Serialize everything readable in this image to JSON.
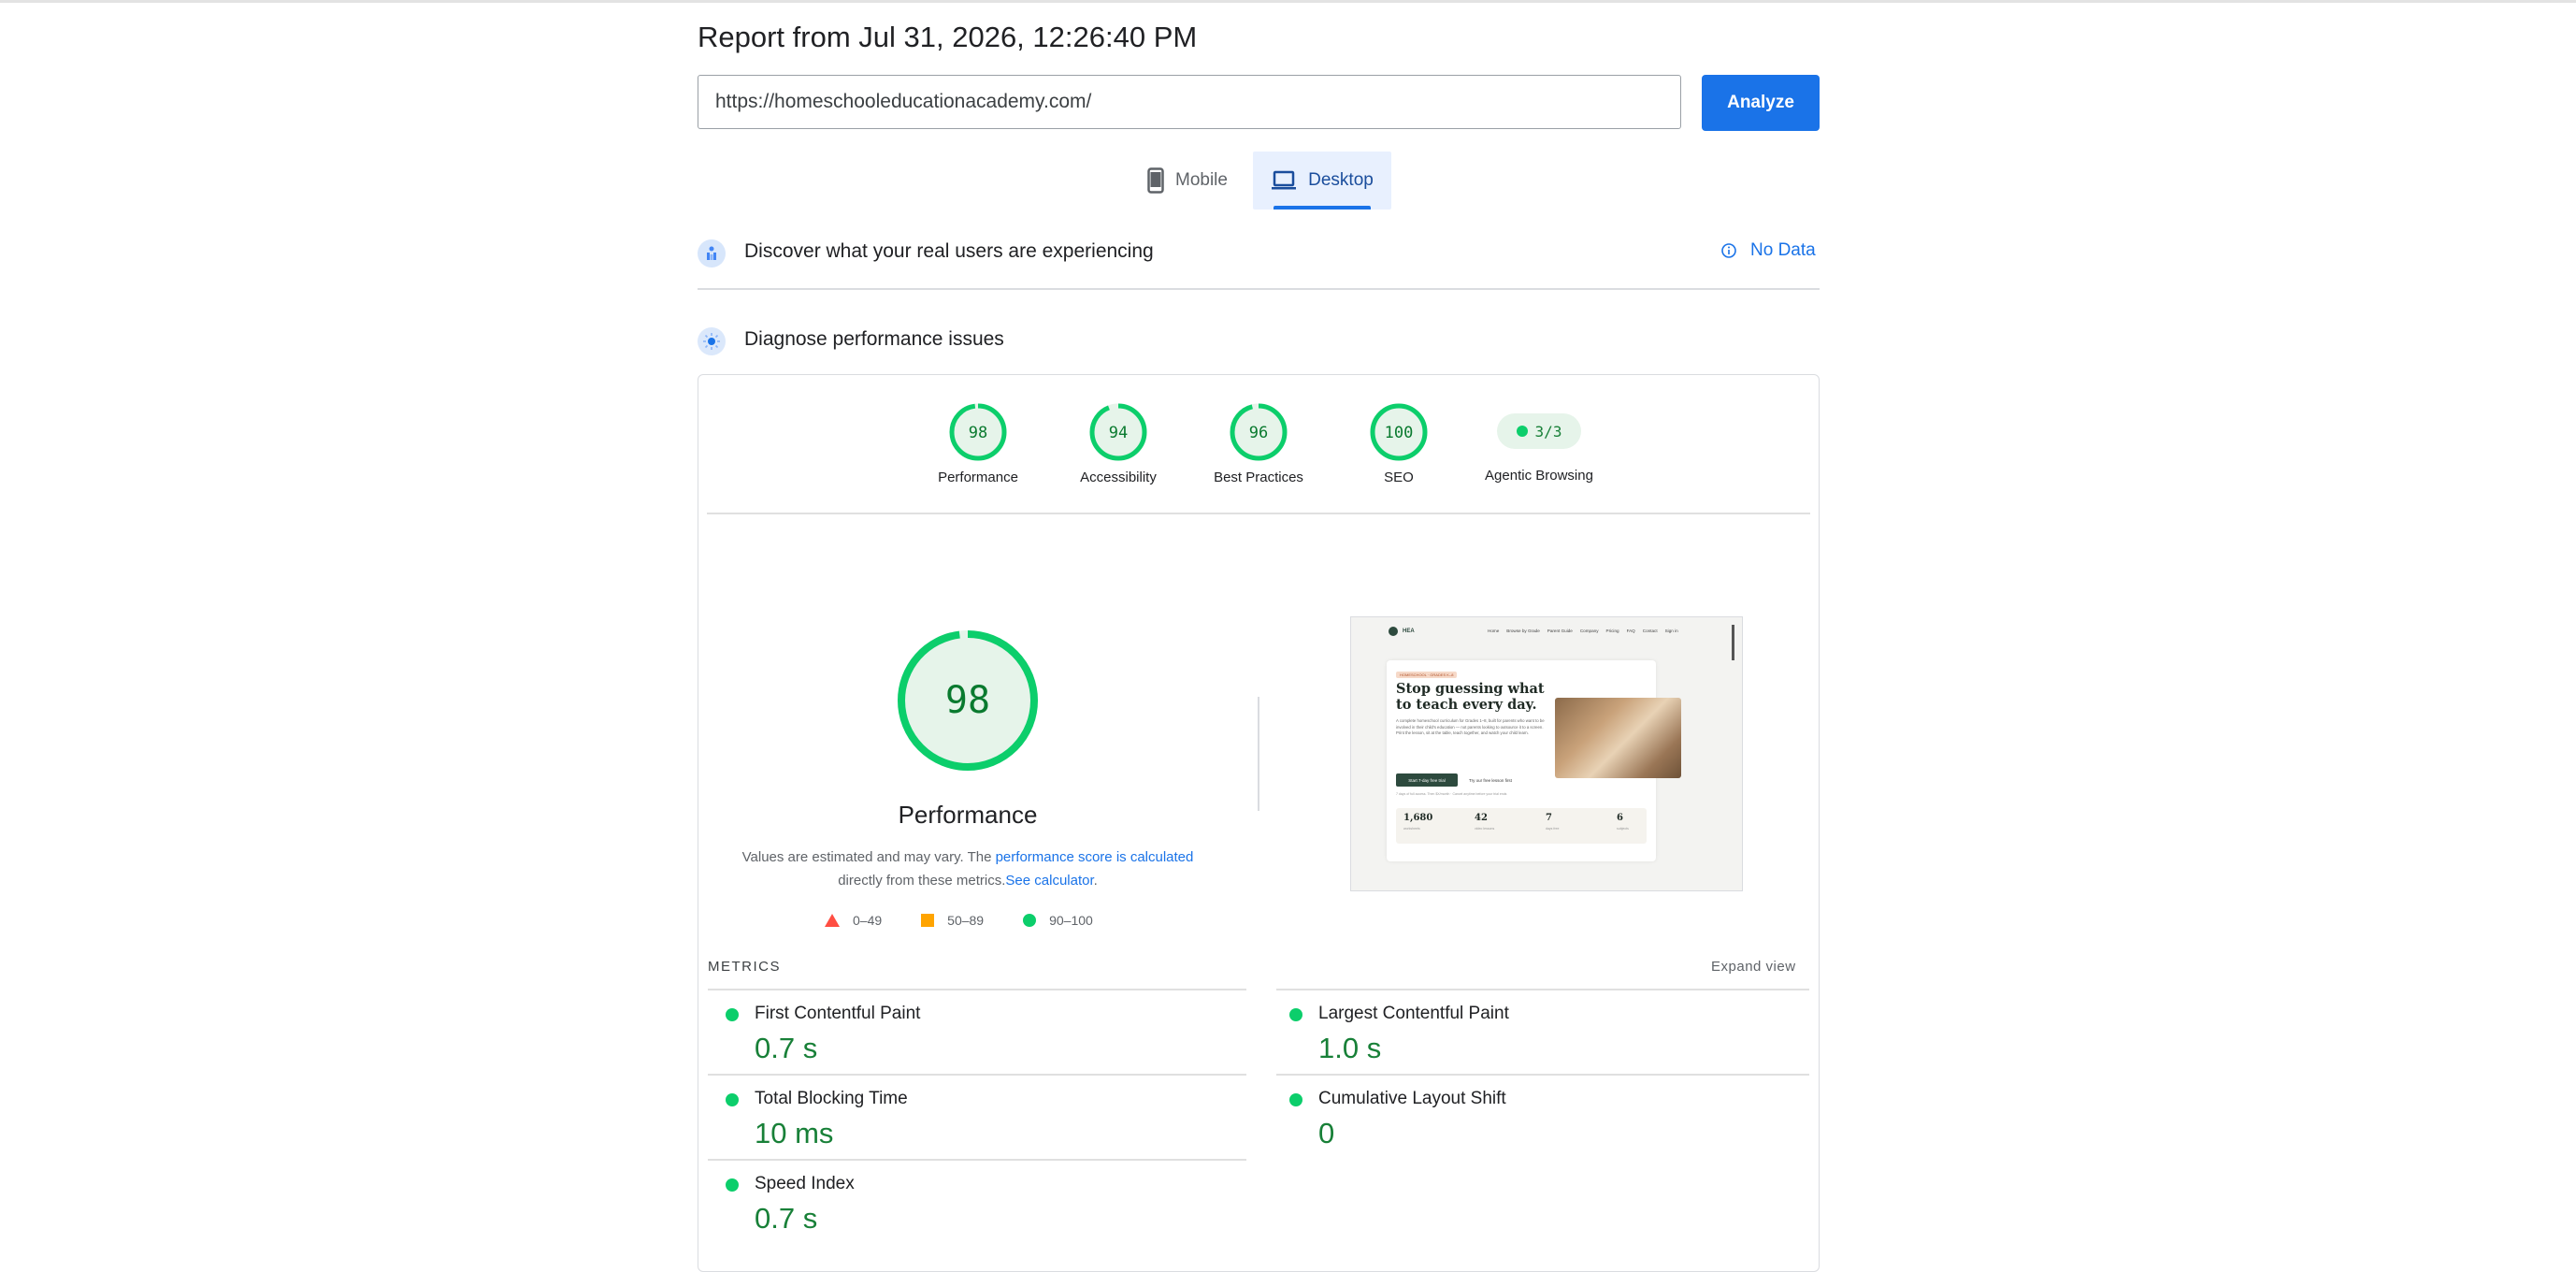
{
  "report": {
    "title": "Report from Jul 31, 2026, 12:26:40 PM"
  },
  "search": {
    "url_value": "https://homeschooleducationacademy.com/",
    "analyze_label": "Analyze"
  },
  "device_tabs": {
    "mobile": "Mobile",
    "desktop": "Desktop",
    "selected": "Desktop"
  },
  "field_data": {
    "heading": "Discover what your real users are experiencing",
    "status": "No Data"
  },
  "lab_data": {
    "heading": "Diagnose performance issues"
  },
  "categories": [
    {
      "label": "Performance",
      "score": "98"
    },
    {
      "label": "Accessibility",
      "score": "94"
    },
    {
      "label": "Best Practices",
      "score": "96"
    },
    {
      "label": "SEO",
      "score": "100"
    },
    {
      "label": "Agentic Browsing",
      "score": "3/3"
    }
  ],
  "performance": {
    "score": "98",
    "label": "Performance",
    "desc_prefix": "Values are estimated and may vary. The ",
    "desc_link1": "performance score is calculated",
    "desc_middle": " directly from these metrics.",
    "desc_link2": "See calculator",
    "desc_suffix": "."
  },
  "legend": {
    "fail": "0–49",
    "average": "50–89",
    "pass": "90–100"
  },
  "metrics": {
    "heading": "METRICS",
    "expand_label": "Expand view",
    "items": [
      {
        "name": "First Contentful Paint",
        "value": "0.7 s"
      },
      {
        "name": "Largest Contentful Paint",
        "value": "1.0 s"
      },
      {
        "name": "Total Blocking Time",
        "value": "10 ms"
      },
      {
        "name": "Cumulative Layout Shift",
        "value": "0"
      },
      {
        "name": "Speed Index",
        "value": "0.7 s"
      }
    ]
  },
  "screenshot": {
    "logo": "HEA",
    "nav": [
      "Home",
      "Browse by Grade",
      "Parent Guide",
      "Company",
      "Pricing",
      "FAQ",
      "Contact",
      "Sign in"
    ],
    "badge": "HOMESCHOOL · GRADES K–8",
    "headline": "Stop guessing what to teach every day.",
    "body": "A complete homeschool curriculum for Grades 1–8, built for parents who want to be involved in their child's education — not parents looking to outsource it to a screen. Print the lesson, sit at the table, teach together, and watch your child learn.",
    "primary_cta": "Start 7-day free trial",
    "secondary_cta": "Try our free lesson first",
    "note": "7 days of full access. Then $X/month · Cancel anytime before your trial ends",
    "stats": [
      "1,680",
      "42",
      "7",
      "6"
    ],
    "stat_labels": [
      "worksheets",
      "video lessons",
      "days free",
      "subjects"
    ]
  },
  "colors": {
    "accent": "#1a73e8",
    "pass": "#0cce6b",
    "pass_text": "#188038",
    "average": "#ffa400",
    "fail": "#ff4e42"
  }
}
